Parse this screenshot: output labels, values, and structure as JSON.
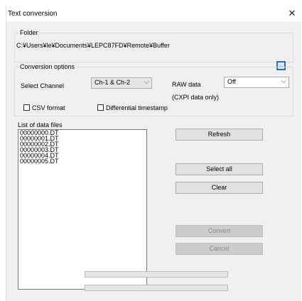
{
  "window": {
    "title": "Text conversion",
    "close_glyph": "✕"
  },
  "folder": {
    "group_label": "Folder",
    "path": "C:¥Users¥le¥Documents¥LEPC87FD¥Remote¥Buffer",
    "browse_glyph": "..."
  },
  "conversion_options": {
    "group_label": "Conversion options",
    "select_channel_label": "Select Channel",
    "select_channel_value": "Ch-1 & Ch-2",
    "raw_data_label": "RAW data",
    "raw_data_value": "Off",
    "raw_data_note": "(CXPI data only)",
    "csv_format_label": "CSV format",
    "csv_format_checked": false,
    "differential_timestamp_label": "Differential timestamp",
    "differential_timestamp_checked": false
  },
  "data_files": {
    "label": "List of data files",
    "items": [
      "00000000.DT",
      "00000001.DT",
      "00000002.DT",
      "00000003.DT",
      "00000004.DT",
      "00000005.DT"
    ]
  },
  "buttons": {
    "refresh": "Refresh",
    "select_all": "Select all",
    "clear": "Clear",
    "convert": "Convert",
    "cancel": "Cancel"
  },
  "progress": {
    "bar1": 0,
    "bar2": 0
  },
  "icons": {
    "dropdown": "chevron-down-icon",
    "close": "close-icon",
    "browse": "folder-browse-icon"
  }
}
